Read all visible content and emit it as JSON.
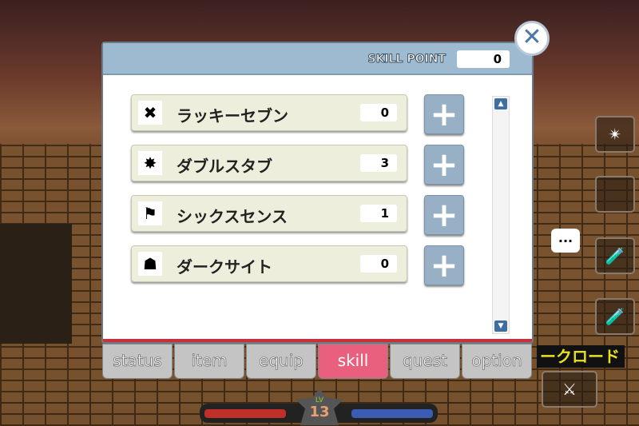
{
  "panel": {
    "skill_point_label": "SKILL POINT",
    "skill_point_value": "0"
  },
  "skills": [
    {
      "name": "ラッキーセブン",
      "level": "0",
      "icon": "lucky-seven-icon"
    },
    {
      "name": "ダブルスタブ",
      "level": "3",
      "icon": "double-stab-icon"
    },
    {
      "name": "シックスセンス",
      "level": "1",
      "icon": "sixth-sense-icon"
    },
    {
      "name": "ダークサイト",
      "level": "0",
      "icon": "dark-sight-icon"
    }
  ],
  "tabs": [
    "status",
    "item",
    "equip",
    "skill",
    "quest",
    "option"
  ],
  "active_tab": "skill",
  "hud": {
    "level_label": "LV",
    "level": "13",
    "map_text": "ークロード",
    "chat": "..."
  },
  "colors": {
    "header": "#9dbad0",
    "active_tab": "#e8607e",
    "plus_button": "#98b0c6"
  }
}
